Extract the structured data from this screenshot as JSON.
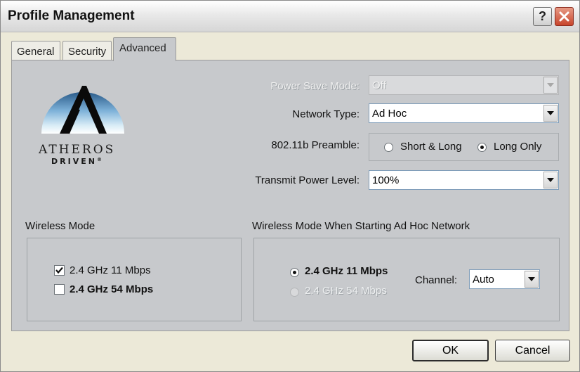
{
  "window": {
    "title": "Profile Management"
  },
  "tabs": [
    {
      "label": "General",
      "active": false
    },
    {
      "label": "Security",
      "active": false
    },
    {
      "label": "Advanced",
      "active": true
    }
  ],
  "logo": {
    "line1": "ATHEROS",
    "line2": "DRIVEN",
    "mark": "®"
  },
  "settings": {
    "power_save": {
      "label": "Power Save Mode:",
      "value": "Off",
      "enabled": false
    },
    "network_type": {
      "label": "Network Type:",
      "value": "Ad Hoc"
    },
    "preamble": {
      "label": "802.11b Preamble:",
      "options": [
        {
          "label": "Short & Long",
          "selected": false
        },
        {
          "label": "Long Only",
          "selected": true
        }
      ]
    },
    "transmit_power": {
      "label": "Transmit Power Level:",
      "value": "100%"
    }
  },
  "wireless_mode": {
    "title": "Wireless Mode",
    "options": [
      {
        "label": "2.4 GHz 11 Mbps",
        "checked": true,
        "bold": false
      },
      {
        "label": "2.4 GHz 54 Mbps",
        "checked": false,
        "bold": true
      }
    ]
  },
  "adhoc_mode": {
    "title": "Wireless Mode When Starting Ad Hoc Network",
    "options": [
      {
        "label": "2.4 GHz 11 Mbps",
        "selected": true,
        "enabled": true
      },
      {
        "label": "2.4 GHz 54 Mbps",
        "selected": false,
        "enabled": false
      }
    ],
    "channel": {
      "label": "Channel:",
      "value": "Auto"
    }
  },
  "buttons": {
    "ok": "OK",
    "cancel": "Cancel"
  },
  "colors": {
    "panel": "#c7c9cc",
    "window": "#ece9d8",
    "close": "#c8452c"
  }
}
